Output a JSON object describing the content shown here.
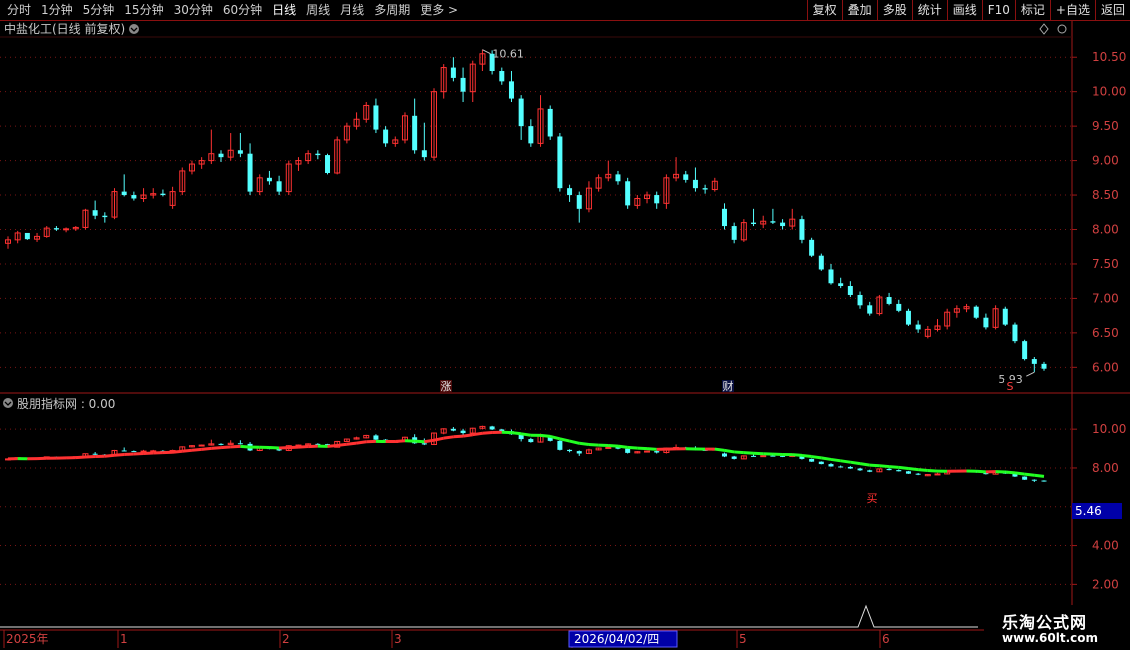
{
  "toolbar": {
    "periods": [
      "分时",
      "1分钟",
      "5分钟",
      "15分钟",
      "30分钟",
      "60分钟",
      "日线",
      "周线",
      "月线",
      "多周期",
      "更多 >"
    ],
    "active_period": "日线",
    "right_buttons": [
      "复权",
      "叠加",
      "多股",
      "统计",
      "画线",
      "F10",
      "标记",
      "+自选",
      "返回"
    ]
  },
  "main_panel": {
    "title": "中盐化工(日线 前复权)",
    "high_label": "10.61",
    "low_label": "5.93",
    "event_markers": [
      "涨",
      "财",
      "S"
    ],
    "y_ticks": [
      "10.50",
      "10.00",
      "9.50",
      "9.00",
      "8.50",
      "8.00",
      "7.50",
      "7.00",
      "6.50",
      "6.00"
    ]
  },
  "indicator_panel": {
    "title": "股朋指标网 : 0.00",
    "current_value": "5.46",
    "y_ticks": [
      "10.00",
      "8.00",
      "4.00",
      "2.00"
    ],
    "signal_marker": "买"
  },
  "time_axis": {
    "labels": [
      "2025年",
      "1",
      "2",
      "3",
      "4",
      "5",
      "6"
    ],
    "cursor_label": "2026/04/02/四"
  },
  "watermark": {
    "line1": "乐淘公式网",
    "line2": "www.60lt.com"
  },
  "colors": {
    "up": "#ff3232",
    "down": "#54ffff",
    "axis": "#a01818",
    "text": "#c8c8c8",
    "green": "#22ff22"
  },
  "chart_data": {
    "type": "candlestick",
    "ylim": [
      5.7,
      10.75
    ],
    "ohlc": [
      [
        7.8,
        7.9,
        7.72,
        7.85
      ],
      [
        7.85,
        7.98,
        7.8,
        7.95
      ],
      [
        7.95,
        7.92,
        7.85,
        7.86
      ],
      [
        7.86,
        7.95,
        7.82,
        7.9
      ],
      [
        7.9,
        8.05,
        7.88,
        8.02
      ],
      [
        8.02,
        8.05,
        7.98,
        8.0
      ],
      [
        8.0,
        8.03,
        7.96,
        8.01
      ],
      [
        8.01,
        8.05,
        7.98,
        8.03
      ],
      [
        8.03,
        8.3,
        8.0,
        8.28
      ],
      [
        8.28,
        8.42,
        8.15,
        8.2
      ],
      [
        8.2,
        8.25,
        8.1,
        8.18
      ],
      [
        8.18,
        8.6,
        8.15,
        8.55
      ],
      [
        8.55,
        8.8,
        8.48,
        8.5
      ],
      [
        8.5,
        8.55,
        8.42,
        8.45
      ],
      [
        8.45,
        8.6,
        8.4,
        8.5
      ],
      [
        8.5,
        8.6,
        8.45,
        8.52
      ],
      [
        8.52,
        8.58,
        8.48,
        8.5
      ],
      [
        8.35,
        8.62,
        8.3,
        8.55
      ],
      [
        8.55,
        8.9,
        8.5,
        8.85
      ],
      [
        8.85,
        9.0,
        8.8,
        8.95
      ],
      [
        8.95,
        9.05,
        8.88,
        9.0
      ],
      [
        9.0,
        9.45,
        8.95,
        9.1
      ],
      [
        9.1,
        9.15,
        8.98,
        9.05
      ],
      [
        9.05,
        9.4,
        9.0,
        9.15
      ],
      [
        9.15,
        9.4,
        9.05,
        9.1
      ],
      [
        9.1,
        9.25,
        8.5,
        8.55
      ],
      [
        8.55,
        8.8,
        8.5,
        8.75
      ],
      [
        8.75,
        8.85,
        8.65,
        8.7
      ],
      [
        8.7,
        8.78,
        8.5,
        8.55
      ],
      [
        8.55,
        9.0,
        8.5,
        8.95
      ],
      [
        8.95,
        9.05,
        8.85,
        9.0
      ],
      [
        9.0,
        9.15,
        8.95,
        9.1
      ],
      [
        9.1,
        9.15,
        9.02,
        9.08
      ],
      [
        9.08,
        9.1,
        8.8,
        8.82
      ],
      [
        8.82,
        9.35,
        8.8,
        9.3
      ],
      [
        9.3,
        9.55,
        9.25,
        9.5
      ],
      [
        9.5,
        9.7,
        9.45,
        9.6
      ],
      [
        9.6,
        9.85,
        9.55,
        9.8
      ],
      [
        9.8,
        9.9,
        9.4,
        9.45
      ],
      [
        9.45,
        9.5,
        9.2,
        9.25
      ],
      [
        9.25,
        9.35,
        9.2,
        9.3
      ],
      [
        9.3,
        9.7,
        9.25,
        9.65
      ],
      [
        9.65,
        9.9,
        9.1,
        9.15
      ],
      [
        9.15,
        9.55,
        9.0,
        9.05
      ],
      [
        9.05,
        10.05,
        9.0,
        10.0
      ],
      [
        10.0,
        10.4,
        9.9,
        10.35
      ],
      [
        10.35,
        10.5,
        10.15,
        10.2
      ],
      [
        10.2,
        10.35,
        9.85,
        10.0
      ],
      [
        10.0,
        10.45,
        9.85,
        10.4
      ],
      [
        10.4,
        10.61,
        10.3,
        10.55
      ],
      [
        10.55,
        10.6,
        10.25,
        10.3
      ],
      [
        10.3,
        10.35,
        10.1,
        10.15
      ],
      [
        10.15,
        10.3,
        9.85,
        9.9
      ],
      [
        9.9,
        9.95,
        9.3,
        9.5
      ],
      [
        9.5,
        9.6,
        9.2,
        9.25
      ],
      [
        9.25,
        9.95,
        9.2,
        9.75
      ],
      [
        9.75,
        9.8,
        9.3,
        9.35
      ],
      [
        9.35,
        9.4,
        8.55,
        8.6
      ],
      [
        8.6,
        8.65,
        8.4,
        8.5
      ],
      [
        8.5,
        8.55,
        8.1,
        8.3
      ],
      [
        8.3,
        8.7,
        8.25,
        8.6
      ],
      [
        8.6,
        8.8,
        8.55,
        8.75
      ],
      [
        8.75,
        9.0,
        8.7,
        8.8
      ],
      [
        8.8,
        8.85,
        8.65,
        8.7
      ],
      [
        8.7,
        8.75,
        8.3,
        8.35
      ],
      [
        8.35,
        8.5,
        8.3,
        8.45
      ],
      [
        8.45,
        8.55,
        8.38,
        8.5
      ],
      [
        8.5,
        8.55,
        8.3,
        8.38
      ],
      [
        8.38,
        8.8,
        8.3,
        8.75
      ],
      [
        8.75,
        9.05,
        8.7,
        8.8
      ],
      [
        8.8,
        8.85,
        8.68,
        8.72
      ],
      [
        8.72,
        8.9,
        8.55,
        8.6
      ],
      [
        8.6,
        8.65,
        8.52,
        8.58
      ],
      [
        8.58,
        8.75,
        8.55,
        8.7
      ],
      [
        8.3,
        8.38,
        8.0,
        8.05
      ],
      [
        8.05,
        8.1,
        7.8,
        7.85
      ],
      [
        7.85,
        8.15,
        7.82,
        8.1
      ],
      [
        8.1,
        8.3,
        8.05,
        8.08
      ],
      [
        8.08,
        8.2,
        8.02,
        8.12
      ],
      [
        8.12,
        8.3,
        8.08,
        8.1
      ],
      [
        8.1,
        8.15,
        8.0,
        8.05
      ],
      [
        8.05,
        8.3,
        8.0,
        8.15
      ],
      [
        8.15,
        8.2,
        7.8,
        7.85
      ],
      [
        7.85,
        7.88,
        7.6,
        7.62
      ],
      [
        7.62,
        7.65,
        7.4,
        7.42
      ],
      [
        7.42,
        7.5,
        7.2,
        7.22
      ],
      [
        7.22,
        7.3,
        7.15,
        7.18
      ],
      [
        7.18,
        7.25,
        7.02,
        7.05
      ],
      [
        7.05,
        7.1,
        6.85,
        6.9
      ],
      [
        6.9,
        6.95,
        6.75,
        6.78
      ],
      [
        6.78,
        7.05,
        6.75,
        7.02
      ],
      [
        7.02,
        7.08,
        6.9,
        6.92
      ],
      [
        6.92,
        6.98,
        6.8,
        6.82
      ],
      [
        6.82,
        6.85,
        6.6,
        6.62
      ],
      [
        6.62,
        6.68,
        6.5,
        6.55
      ],
      [
        6.45,
        6.6,
        6.42,
        6.55
      ],
      [
        6.55,
        6.7,
        6.52,
        6.6
      ],
      [
        6.6,
        6.85,
        6.55,
        6.8
      ],
      [
        6.8,
        6.9,
        6.72,
        6.85
      ],
      [
        6.85,
        6.92,
        6.8,
        6.88
      ],
      [
        6.88,
        6.9,
        6.7,
        6.72
      ],
      [
        6.72,
        6.78,
        6.55,
        6.58
      ],
      [
        6.58,
        6.9,
        6.55,
        6.85
      ],
      [
        6.85,
        6.88,
        6.6,
        6.62
      ],
      [
        6.62,
        6.65,
        6.35,
        6.38
      ],
      [
        6.38,
        6.4,
        6.1,
        6.12
      ],
      [
        6.12,
        6.15,
        5.93,
        6.05
      ],
      [
        6.05,
        6.08,
        5.95,
        5.98
      ]
    ]
  }
}
